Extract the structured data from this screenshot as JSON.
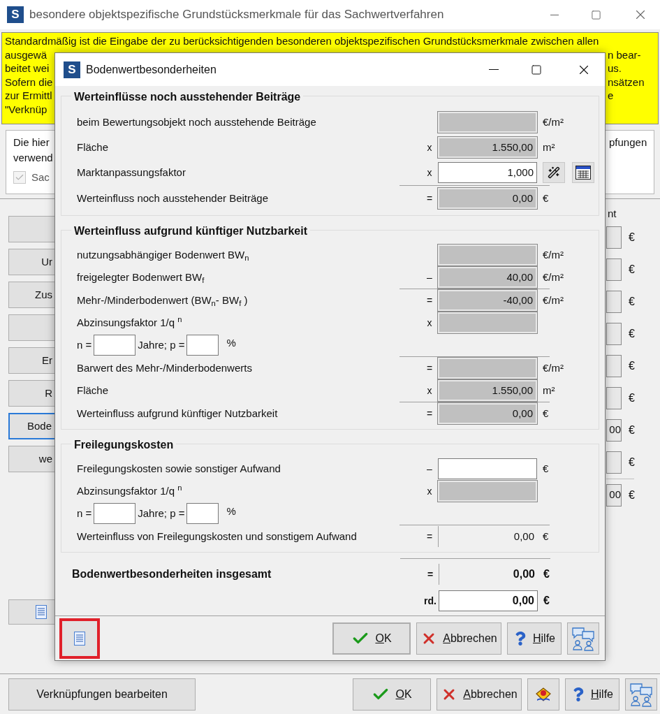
{
  "window": {
    "icon": "S",
    "title": "besondere objektspezifische Grundstücksmerkmale für das Sachwertverfahren"
  },
  "note": {
    "first_line": "Standardmäßig ist die Eingabe der zu berücksichtigenden besonderen objektspezifischen Grundstücksmerkmale zwischen allen",
    "lines": [
      {
        "left": "ausgewä",
        "right": "n bear-"
      },
      {
        "left": "beitet wei",
        "right": "us."
      },
      {
        "left": "Sofern die",
        "right": "nsätzen"
      },
      {
        "left": "zur Ermittl",
        "right": "e"
      },
      {
        "left": "\"Verknüp"
      }
    ]
  },
  "group": {
    "left_lines": [
      "Die hier",
      "verwend"
    ],
    "checkbox": {
      "label": "Sac",
      "checked": true,
      "disabled": true
    },
    "right_fragment": "pfungen"
  },
  "side_buttons": [
    {
      "focused": false
    },
    {
      "label": "Ur",
      "focused": false
    },
    {
      "label": "Zus",
      "focused": false
    },
    {
      "focused": false
    },
    {
      "label": "Er",
      "focused": false
    },
    {
      "label": "R",
      "focused": false
    },
    {
      "label": "Bode",
      "focused": true
    },
    {
      "label": "we",
      "focused": false
    }
  ],
  "right_column": {
    "heading": "nt",
    "fields": [
      {
        "unit": "€"
      },
      {
        "unit": "€"
      },
      {
        "unit": "€"
      },
      {
        "unit": "€"
      },
      {
        "unit": "€"
      },
      {
        "unit": "€"
      },
      {
        "value": "00",
        "unit": "€"
      },
      {
        "unit": "€"
      },
      {
        "value": "00",
        "unit": "€",
        "rule_above": true
      }
    ]
  },
  "footer": {
    "edit_button": "Verknüpfungen bearbeiten",
    "ok": "OK",
    "cancel": "Abbrechen",
    "help": "Hilfe"
  },
  "dialog": {
    "icon": "S",
    "title": "Bodenwertbesonderheiten",
    "sections": [
      {
        "title": "Werteinflüsse noch ausstehender Beiträge",
        "rows": [
          {
            "kind": "field",
            "label": "beim Bewertungsobjekt noch ausstehende Beiträge",
            "unit": "€/m²",
            "editable": false
          },
          {
            "kind": "field",
            "label": "Fläche",
            "op": "x",
            "value": "1.550,00",
            "unit": "m²",
            "editable": false
          },
          {
            "kind": "field",
            "label": "Marktanpassungsfaktor",
            "op": "x",
            "value": "1,000",
            "editable": true,
            "tools": true
          },
          {
            "kind": "field",
            "label": "Werteinfluss noch ausstehender Beiträge",
            "op": "=",
            "value": "0,00",
            "unit": "€",
            "editable": false,
            "rule_above": true
          }
        ]
      },
      {
        "title": "Werteinfluss aufgrund künftiger Nutzbarkeit",
        "rows": [
          {
            "kind": "field",
            "label": "nutzungsabhängiger Bodenwert BW$_{n}$",
            "unit": "€/m²",
            "editable": false
          },
          {
            "kind": "field",
            "label": "freigelegter Bodenwert BW$_{f}$",
            "op": "–",
            "value": "40,00",
            "unit": "€/m²",
            "editable": false
          },
          {
            "kind": "field",
            "label": "Mehr-/Minderbodenwert (BW$_{n}$- BW$_{f}$ )",
            "op": "=",
            "value": "-40,00",
            "unit": "€/m²",
            "editable": false,
            "rule_above": true
          },
          {
            "kind": "discount",
            "label": "Abzinsungsfaktor 1/q $^{n}$",
            "op": "x",
            "editable": false,
            "n_label": "n =",
            "p_label": "Jahre; p =",
            "percent": "%"
          },
          {
            "kind": "field",
            "label": "Barwert des Mehr-/Minderbodenwerts",
            "op": "=",
            "unit": "€/m²",
            "editable": false,
            "rule_above": true
          },
          {
            "kind": "field",
            "label": "Fläche",
            "op": "x",
            "value": "1.550,00",
            "unit": "m²",
            "editable": false
          },
          {
            "kind": "field",
            "label": "Werteinfluss aufgrund künftiger Nutzbarkeit",
            "op": "=",
            "value": "0,00",
            "unit": "€",
            "editable": false,
            "rule_above": true
          }
        ]
      },
      {
        "title": "Freilegungskosten",
        "rows": [
          {
            "kind": "field",
            "label": "Freilegungskosten sowie sonstiger Aufwand",
            "op": "–",
            "unit": "€",
            "editable": true
          },
          {
            "kind": "discount",
            "label": "Abzinsungsfaktor 1/q $^{n}$",
            "op": "x",
            "editable": false,
            "n_label": "n =",
            "p_label": "Jahre; p =",
            "percent": "%"
          },
          {
            "kind": "result",
            "label": "Werteinfluss von Freilegungskosten und sonstigem Aufwand",
            "op": "=",
            "value": "0,00",
            "unit": "€",
            "editable": false,
            "rule_above": true
          }
        ]
      }
    ],
    "total": {
      "kind": "result",
      "label": "Bodenwertbesonderheiten insgesamt",
      "op": "=",
      "value": "0,00",
      "unit": "€",
      "editable": false
    },
    "rounded": {
      "op": "rd.",
      "value": "0,00",
      "unit": "€",
      "editable": true
    },
    "doc_button": {
      "highlighted": true
    },
    "ok": "OK",
    "cancel": "Abbrechen",
    "help": "Hilfe"
  }
}
